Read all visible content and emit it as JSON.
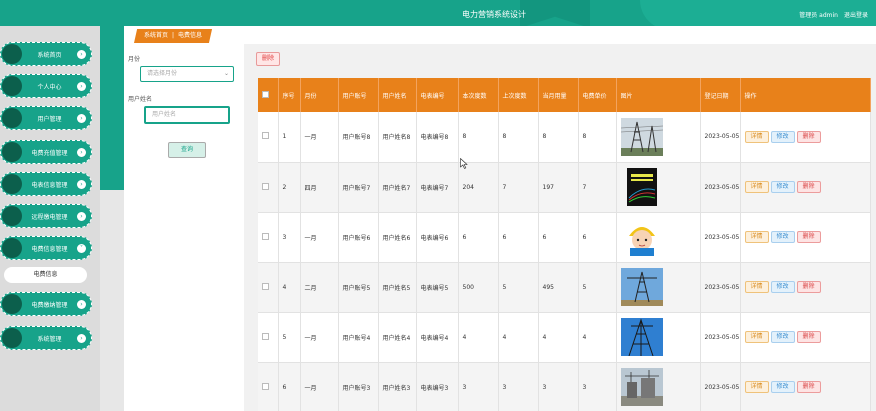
{
  "header": {
    "title": "电力营销系统设计",
    "user": "管理员 admin",
    "logout": "退出登录"
  },
  "sidebar": {
    "items": [
      {
        "label": "系统首页"
      },
      {
        "label": "个人中心"
      },
      {
        "label": "用户管理"
      },
      {
        "label": "电费充值管理"
      },
      {
        "label": "电表信息管理"
      },
      {
        "label": "远程缴电管理"
      },
      {
        "label": "电费信息管理"
      },
      {
        "label": "电费缴纳管理"
      },
      {
        "label": "系统管理"
      }
    ],
    "sub_active": "电费信息"
  },
  "breadcrumb": {
    "root": "系统首页",
    "current": "电费信息"
  },
  "filter": {
    "month_label": "月份",
    "month_placeholder": "请选择月份",
    "name_label": "用户姓名",
    "name_placeholder": "用户姓名",
    "query_label": "查询"
  },
  "toolbar": {
    "delete_label": "删除"
  },
  "table": {
    "headers": [
      "序号",
      "月份",
      "用户账号",
      "用户姓名",
      "电表编号",
      "本次度数",
      "上次度数",
      "当月用量",
      "电费单价",
      "图片",
      "登记日期",
      "操作"
    ],
    "actions": {
      "detail": "详情",
      "edit": "修改",
      "delete": "删除"
    },
    "rows": [
      {
        "no": "1",
        "month": "一月",
        "account": "用户账号8",
        "name": "用户姓名8",
        "meter": "电表编号8",
        "cur": "8",
        "last": "8",
        "usage": "8",
        "price": "8",
        "date": "2023-05-05",
        "image": "power-tower-photo"
      },
      {
        "no": "2",
        "month": "四月",
        "account": "用户账号7",
        "name": "用户姓名7",
        "meter": "电表编号7",
        "cur": "204",
        "last": "7",
        "usage": "197",
        "price": "7",
        "date": "2023-05-05",
        "image": "power-book-cover"
      },
      {
        "no": "3",
        "month": "一月",
        "account": "用户账号6",
        "name": "用户姓名6",
        "meter": "电表编号6",
        "cur": "6",
        "last": "6",
        "usage": "6",
        "price": "6",
        "date": "2023-05-05",
        "image": "worker-cartoon"
      },
      {
        "no": "4",
        "month": "二月",
        "account": "用户账号5",
        "name": "用户姓名5",
        "meter": "电表编号5",
        "cur": "500",
        "last": "5",
        "usage": "495",
        "price": "5",
        "date": "2023-05-05",
        "image": "transmission-tower-photo"
      },
      {
        "no": "5",
        "month": "一月",
        "account": "用户账号4",
        "name": "用户姓名4",
        "meter": "电表编号4",
        "cur": "4",
        "last": "4",
        "usage": "4",
        "price": "4",
        "date": "2023-05-05",
        "image": "tower-blue-sky-photo"
      },
      {
        "no": "6",
        "month": "一月",
        "account": "用户账号3",
        "name": "用户姓名3",
        "meter": "电表编号3",
        "cur": "3",
        "last": "3",
        "usage": "3",
        "price": "3",
        "date": "2023-05-05",
        "image": "substation-photo"
      }
    ]
  },
  "colors": {
    "teal": "#17a38a",
    "orange": "#e8811a"
  }
}
